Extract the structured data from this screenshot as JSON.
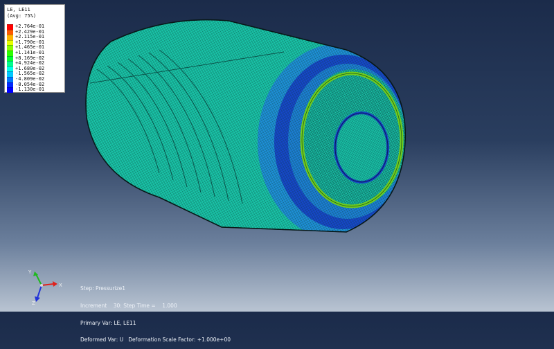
{
  "legend": {
    "title": "LE, LE11",
    "subtitle": "(Avg: 75%)",
    "entries": [
      {
        "label": "+2.764e-01",
        "color": "#ff0000"
      },
      {
        "label": "+2.429e-01",
        "color": "#ff5a00"
      },
      {
        "label": "+2.115e-01",
        "color": "#ffb400"
      },
      {
        "label": "+1.790e-01",
        "color": "#e8ff00"
      },
      {
        "label": "+1.465e-01",
        "color": "#8cff00"
      },
      {
        "label": "+1.141e-01",
        "color": "#2dff00"
      },
      {
        "label": "+8.169e-02",
        "color": "#00ff32"
      },
      {
        "label": "+4.924e-02",
        "color": "#00ff8c"
      },
      {
        "label": "+1.680e-02",
        "color": "#00ffe6"
      },
      {
        "label": "-1.565e-02",
        "color": "#00c8ff"
      },
      {
        "label": "-4.809e-02",
        "color": "#0078ff"
      },
      {
        "label": "-8.054e-02",
        "color": "#0028ff"
      },
      {
        "label": "-1.130e-01",
        "color": "#0000ff"
      }
    ]
  },
  "step_info": {
    "step": "Step: Pressurize1",
    "increment": "Increment    30: Step Time =    1.000",
    "primary_var": "Primary Var: LE, LE11",
    "deformed_var": "Deformed Var: U   Deformation Scale Factor: +1.000e+00"
  },
  "triad": {
    "x_label": "X",
    "y_label": "Y",
    "z_label": "Z",
    "colors": {
      "x": "#e0201a",
      "y": "#1fb81f",
      "z": "#2233d8"
    }
  },
  "model_colors": {
    "body": "#19c2a6",
    "band_light": "#1e8fd6",
    "band_dark": "#1646c8",
    "ring_hot": "#72cc1c",
    "mesh": "#0a3a36"
  }
}
